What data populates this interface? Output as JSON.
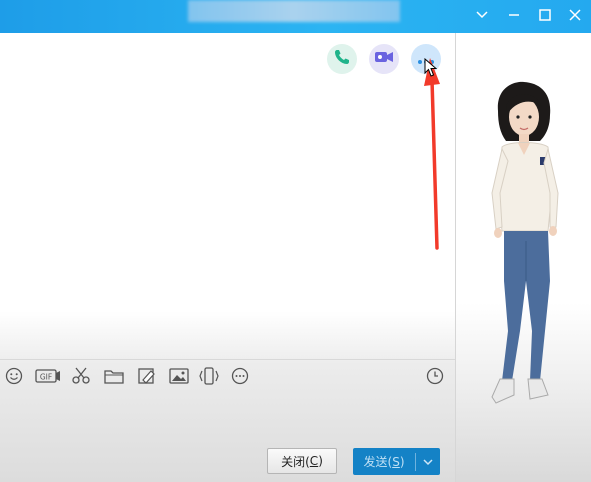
{
  "titlebar": {
    "title": "",
    "window_buttons": [
      "chevron-down-icon",
      "minimize-icon",
      "maximize-icon",
      "close-icon"
    ]
  },
  "header_actions": [
    "phone-call-icon",
    "video-call-icon",
    "more-options-icon"
  ],
  "toolbar": {
    "tools": [
      "emoji-icon",
      "gif-icon",
      "scissors-icon",
      "folder-icon",
      "doodle-icon",
      "image-icon",
      "shake-icon",
      "more-tools-icon"
    ],
    "history": "clock-icon"
  },
  "buttons": {
    "close_prefix": "关闭(",
    "close_key": "C",
    "close_suffix": ")",
    "send_prefix": "发送(",
    "send_key": "S",
    "send_suffix": ")"
  },
  "colors": {
    "titlebar": "#2bb4f2",
    "send_button": "#1482c6",
    "phone": "#1fb38a",
    "video": "#6a63e0",
    "more": "#2b8fe0",
    "annotation_arrow": "#f23a2a"
  }
}
